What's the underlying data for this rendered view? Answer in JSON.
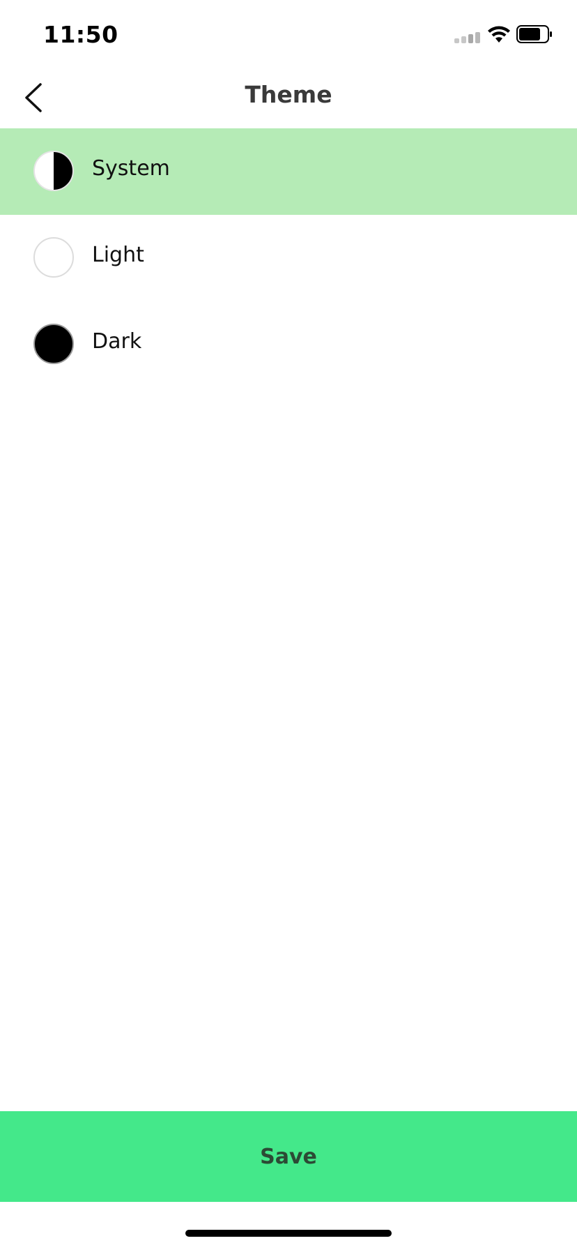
{
  "status_bar": {
    "time": "11:50",
    "icons": [
      "cellular-signal-icon",
      "wifi-icon",
      "battery-icon"
    ]
  },
  "header": {
    "title": "Theme",
    "back_icon": "chevron-left-icon"
  },
  "options": [
    {
      "label": "System",
      "swatch": "half-white-half-black",
      "selected": true
    },
    {
      "label": "Light",
      "swatch": "white",
      "selected": false
    },
    {
      "label": "Dark",
      "swatch": "black",
      "selected": false
    }
  ],
  "footer": {
    "save_label": "Save"
  },
  "colors": {
    "selected_row": "#b5ebb6",
    "save_button": "#44e88a",
    "save_text": "#2c4a35",
    "title_text": "#3a3a3a"
  }
}
